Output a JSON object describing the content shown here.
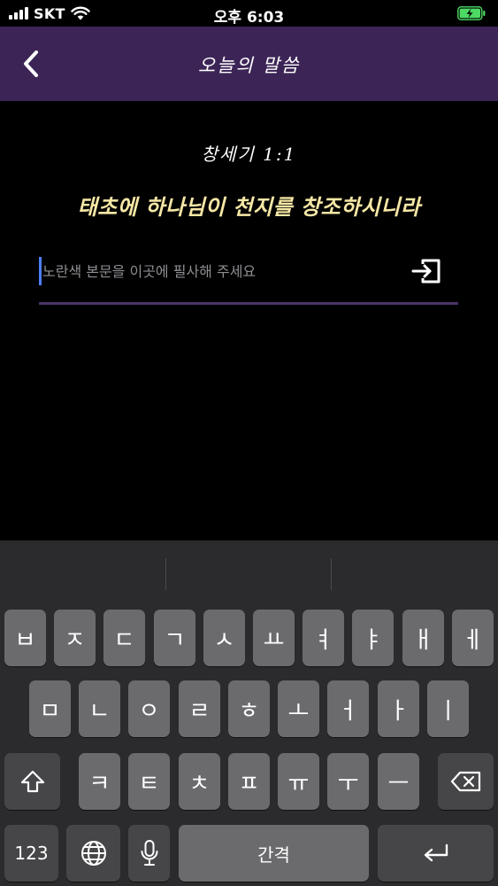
{
  "status_bar": {
    "carrier": "SKT",
    "time": "오후 6:03",
    "icons": [
      "signal-icon",
      "wifi-icon",
      "battery-charging-icon"
    ]
  },
  "nav": {
    "title": "오늘의 말씀",
    "back_icon": "chevron-left-icon"
  },
  "verse": {
    "reference": "창세기 1:1",
    "text": "태초에 하나님이 천지를 창조하시니라"
  },
  "input": {
    "value": "",
    "placeholder": "노란색 본문을 이곳에 필사해 주세요",
    "submit_icon": "submit-enter-icon"
  },
  "keyboard": {
    "row1": [
      "ㅂ",
      "ㅈ",
      "ㄷ",
      "ㄱ",
      "ㅅ",
      "ㅛ",
      "ㅕ",
      "ㅑ",
      "ㅐ",
      "ㅔ"
    ],
    "row2": [
      "ㅁ",
      "ㄴ",
      "ㅇ",
      "ㄹ",
      "ㅎ",
      "ㅗ",
      "ㅓ",
      "ㅏ",
      "ㅣ"
    ],
    "row3": [
      "ㅋ",
      "ㅌ",
      "ㅊ",
      "ㅍ",
      "ㅠ",
      "ㅜ",
      "ㅡ"
    ],
    "numbers_label": "123",
    "space_label": "간격",
    "icons": [
      "shift-icon",
      "delete-icon",
      "globe-icon",
      "microphone-icon",
      "return-icon"
    ]
  },
  "colors": {
    "nav_bg": "#3c2556",
    "verse_text": "#f5e7a5",
    "underline": "#4b3466",
    "cursor": "#4d7fff",
    "battery": "#4cd964"
  }
}
